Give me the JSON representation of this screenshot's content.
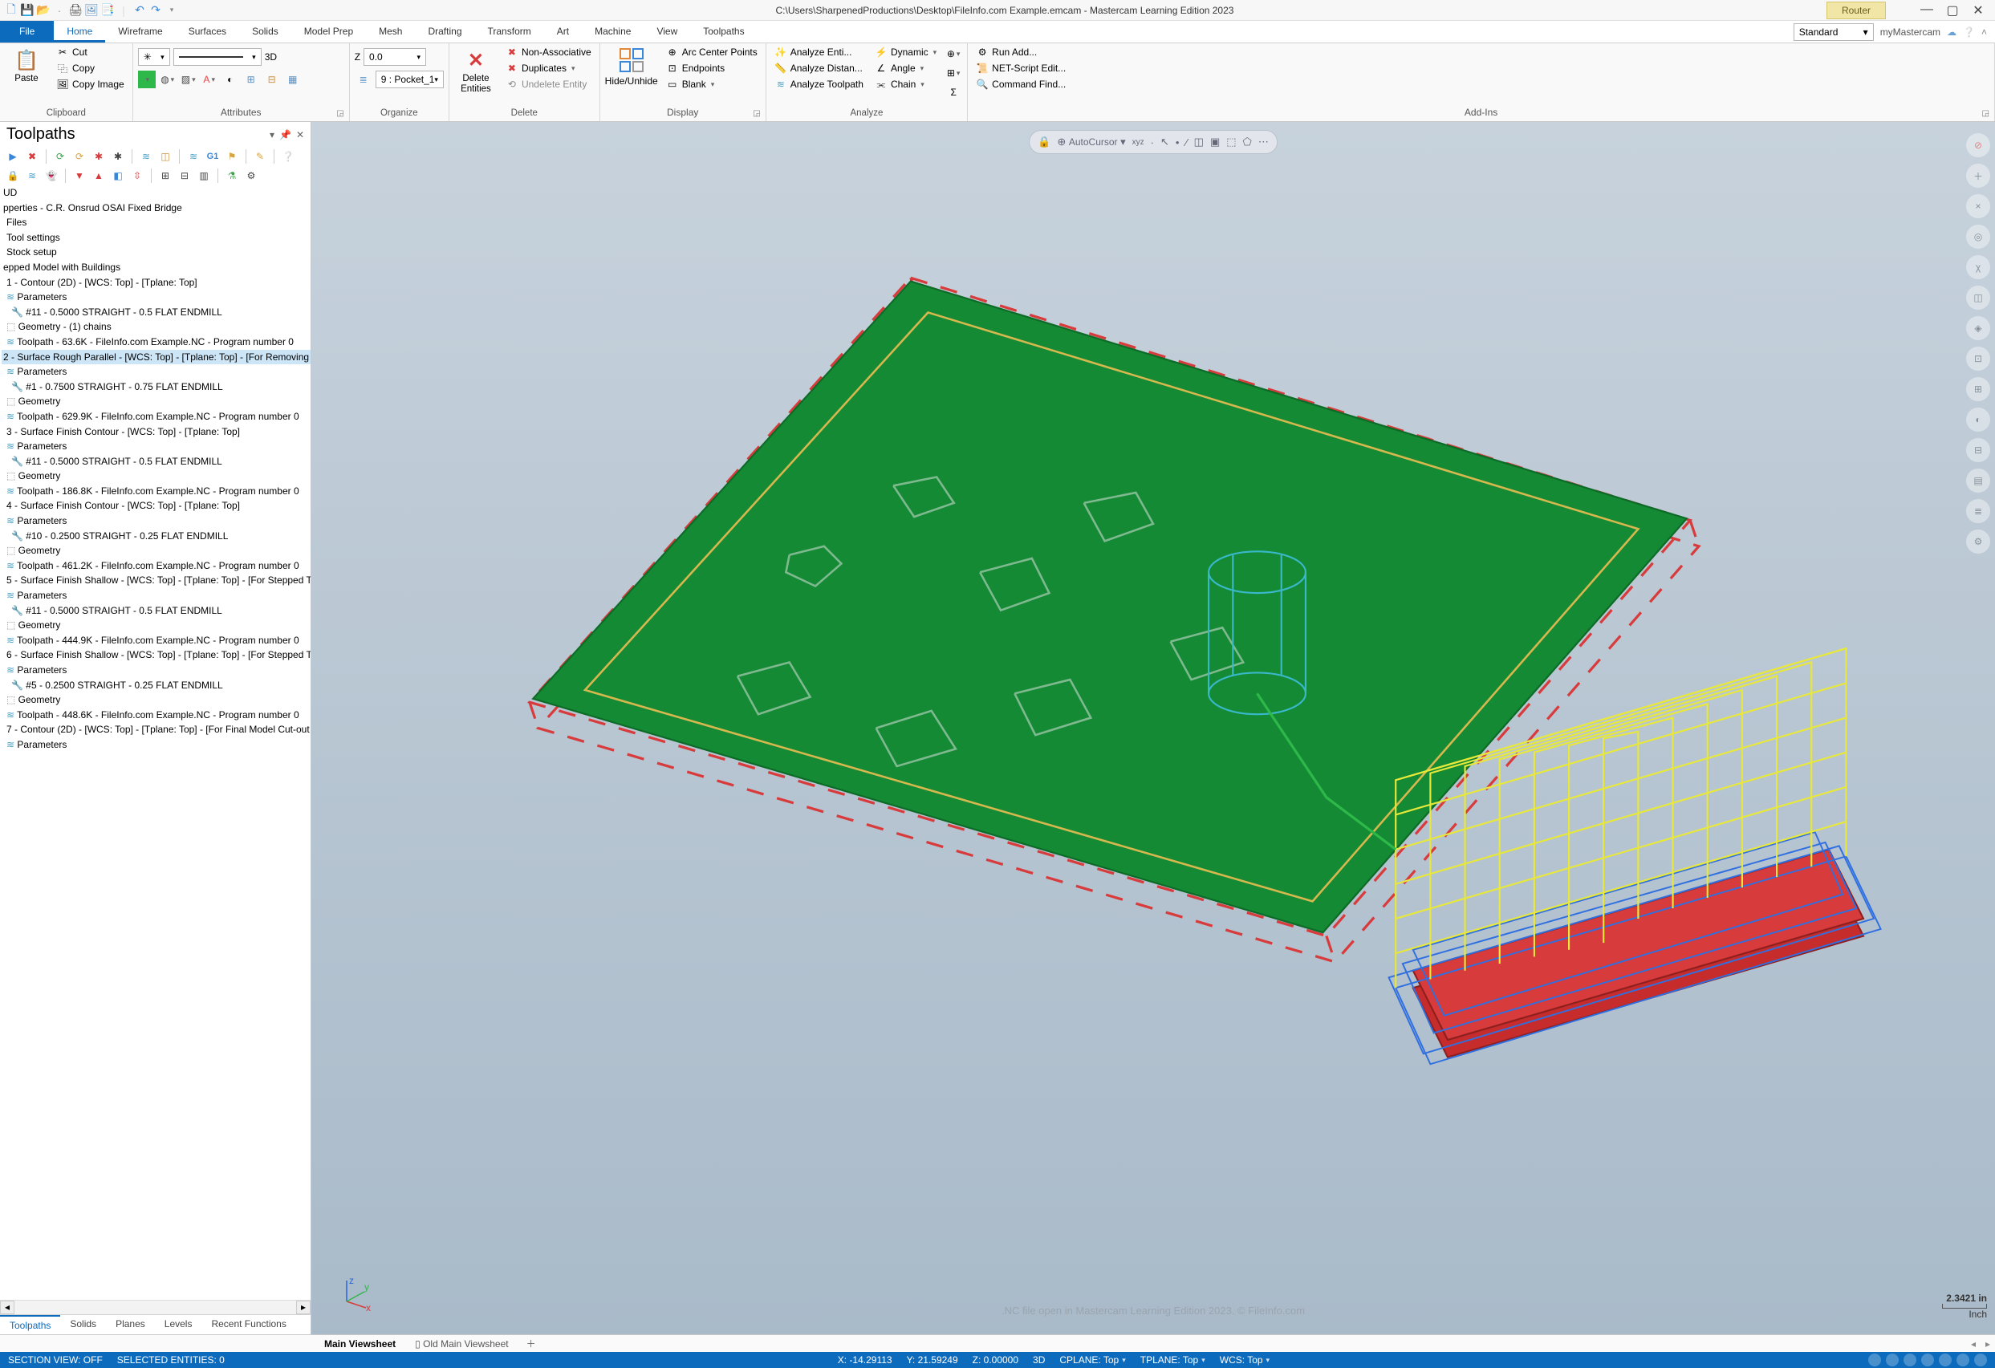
{
  "title": {
    "filepath": "C:\\Users\\SharpenedProductions\\Desktop\\FileInfo.com Example.emcam - Mastercam Learning Edition 2023",
    "context_tab": "Router"
  },
  "tabs": {
    "file": "File",
    "list": [
      "Home",
      "Wireframe",
      "Surfaces",
      "Solids",
      "Model Prep",
      "Mesh",
      "Drafting",
      "Transform",
      "Art",
      "Machine",
      "View",
      "Toolpaths"
    ],
    "active": "Home",
    "right_combo": "Standard",
    "my_mastercam": "myMastercam"
  },
  "ribbon": {
    "clipboard": {
      "label": "Clipboard",
      "paste": "Paste",
      "cut": "Cut",
      "copy": "Copy",
      "copy_image": "Copy Image"
    },
    "attributes": {
      "label": "Attributes",
      "mode3d": "3D"
    },
    "organize": {
      "label": "Organize",
      "z_label": "Z",
      "z_value": "0.0",
      "level_combo": "9 : Pocket_1"
    },
    "delete": {
      "label": "Delete",
      "big": "Delete Entities",
      "non_assoc": "Non-Associative",
      "dup": "Duplicates",
      "undelete": "Undelete Entity"
    },
    "display": {
      "label": "Display",
      "big": "Hide/Unhide",
      "arc": "Arc Center Points",
      "endpoints": "Endpoints",
      "blank": "Blank"
    },
    "analyze": {
      "label": "Analyze",
      "entity": "Analyze Enti...",
      "distance": "Analyze Distan...",
      "toolpath": "Analyze Toolpath",
      "dynamic": "Dynamic",
      "angle": "Angle",
      "chain": "Chain"
    },
    "addins": {
      "label": "Add-Ins",
      "run": "Run Add...",
      "net": "NET-Script Edit...",
      "cmd": "Command Find..."
    }
  },
  "sidepanel": {
    "title": "Toolpaths",
    "tree": [
      {
        "t": "UD",
        "i": 0
      },
      {
        "t": "pperties - C.R. Onsrud OSAI Fixed Bridge",
        "i": 0
      },
      {
        "t": "Files",
        "i": 1
      },
      {
        "t": "Tool settings",
        "i": 1
      },
      {
        "t": "Stock setup",
        "i": 1
      },
      {
        "t": "epped Model with Buildings",
        "i": 0
      },
      {
        "t": "1 - Contour (2D) - [WCS: Top] - [Tplane: Top]",
        "i": 1
      },
      {
        "t": "Parameters",
        "i": 1,
        "ico": "≋"
      },
      {
        "t": "#11 - 0.5000 STRAIGHT - 0.5 FLAT ENDMILL",
        "i": 2,
        "ico": "🔧"
      },
      {
        "t": "Geometry - (1) chains",
        "i": 1,
        "ico": "⬚"
      },
      {
        "t": "Toolpath - 63.6K - FileInfo.com Example.NC - Program number 0",
        "i": 1,
        "ico": "≋"
      },
      {
        "t": "2 - Surface Rough Parallel - [WCS: Top] - [Tplane: Top] - [For Removing",
        "i": 0,
        "sel": true
      },
      {
        "t": "Parameters",
        "i": 1,
        "ico": "≋"
      },
      {
        "t": "#1 - 0.7500 STRAIGHT - 0.75 FLAT ENDMILL",
        "i": 2,
        "ico": "🔧"
      },
      {
        "t": "Geometry",
        "i": 1,
        "ico": "⬚"
      },
      {
        "t": "Toolpath - 629.9K - FileInfo.com Example.NC - Program number 0",
        "i": 1,
        "ico": "≋"
      },
      {
        "t": " ",
        "i": 0
      },
      {
        "t": "3 - Surface Finish Contour - [WCS: Top] - [Tplane: Top]",
        "i": 1
      },
      {
        "t": "Parameters",
        "i": 1,
        "ico": "≋"
      },
      {
        "t": "#11 - 0.5000 STRAIGHT - 0.5 FLAT ENDMILL",
        "i": 2,
        "ico": "🔧"
      },
      {
        "t": "Geometry",
        "i": 1,
        "ico": "⬚"
      },
      {
        "t": "Toolpath - 186.8K - FileInfo.com Example.NC - Program number 0",
        "i": 1,
        "ico": "≋"
      },
      {
        "t": "4 - Surface Finish Contour - [WCS: Top] - [Tplane: Top]",
        "i": 1
      },
      {
        "t": "Parameters",
        "i": 1,
        "ico": "≋"
      },
      {
        "t": "#10 - 0.2500 STRAIGHT - 0.25 FLAT ENDMILL",
        "i": 2,
        "ico": "🔧"
      },
      {
        "t": "Geometry",
        "i": 1,
        "ico": "⬚"
      },
      {
        "t": "Toolpath - 461.2K - FileInfo.com Example.NC - Program number 0",
        "i": 1,
        "ico": "≋"
      },
      {
        "t": "5 - Surface Finish Shallow - [WCS: Top] - [Tplane: Top] - [For Stepped T",
        "i": 1
      },
      {
        "t": "Parameters",
        "i": 1,
        "ico": "≋"
      },
      {
        "t": "#11 - 0.5000 STRAIGHT - 0.5 FLAT ENDMILL",
        "i": 2,
        "ico": "🔧"
      },
      {
        "t": "Geometry",
        "i": 1,
        "ico": "⬚"
      },
      {
        "t": "Toolpath - 444.9K - FileInfo.com Example.NC - Program number 0",
        "i": 1,
        "ico": "≋"
      },
      {
        "t": "6 - Surface Finish Shallow - [WCS: Top] - [Tplane: Top] - [For Stepped T",
        "i": 1
      },
      {
        "t": "Parameters",
        "i": 1,
        "ico": "≋"
      },
      {
        "t": "#5 - 0.2500 STRAIGHT - 0.25 FLAT ENDMILL",
        "i": 2,
        "ico": "🔧"
      },
      {
        "t": "Geometry",
        "i": 1,
        "ico": "⬚"
      },
      {
        "t": "Toolpath - 448.6K - FileInfo.com Example.NC - Program number 0",
        "i": 1,
        "ico": "≋"
      },
      {
        "t": "7 - Contour (2D) - [WCS: Top] - [Tplane: Top] - [For Final Model Cut-out",
        "i": 1
      },
      {
        "t": "Parameters",
        "i": 1,
        "ico": "≋"
      }
    ],
    "bottom_tabs": [
      "Toolpaths",
      "Solids",
      "Planes",
      "Levels",
      "Recent Functions"
    ]
  },
  "view": {
    "autocursor": "AutoCursor",
    "watermark": ".NC file open in Mastercam Learning Edition 2023. © FileInfo.com",
    "scale_value": "2.3421 in",
    "scale_unit": "Inch",
    "tabs": {
      "active": "Main Viewsheet",
      "other": "Old Main Viewsheet"
    }
  },
  "status": {
    "section": "SECTION VIEW: OFF",
    "selected": "SELECTED ENTITIES: 0",
    "x": "X: -14.29113",
    "y": "Y: 21.59249",
    "z": "Z: 0.00000",
    "mode": "3D",
    "cplane": "CPLANE: Top",
    "tplane": "TPLANE: Top",
    "wcs": "WCS: Top"
  }
}
